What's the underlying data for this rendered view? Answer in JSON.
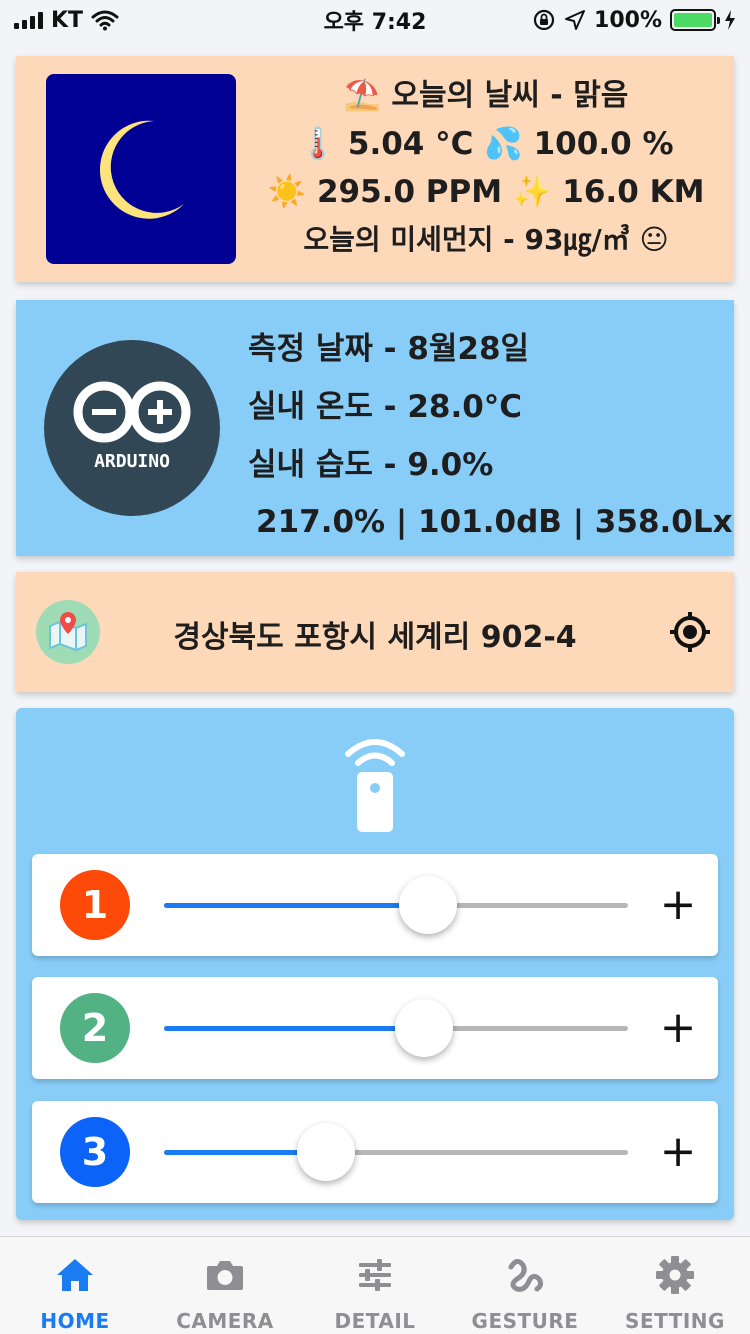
{
  "status_bar": {
    "carrier": "KT",
    "time": "오후 7:42",
    "battery": "100%",
    "battery_level": 1.0
  },
  "weather": {
    "icon": "moon-icon",
    "title_emoji": "⛱️",
    "title": "오늘의 날씨 - 맑음",
    "temp_emoji": "🌡️",
    "temperature": "5.04 °C",
    "humidity_emoji": "💦",
    "humidity": "100.0 %",
    "sun_emoji": "☀️",
    "ppm": "295.0 PPM",
    "sparkle_emoji": "✨",
    "visibility": "16.0 KM",
    "dust": "오늘의 미세먼지 - 93㎍/㎥",
    "dust_emoji": "😐"
  },
  "arduino": {
    "logo_text": "ARDUINO",
    "date": "측정 날짜 - 8월28일",
    "indoor_temp": "실내 온도 - 28.0°C",
    "indoor_humidity": "실내 습도 - 9.0%",
    "stats": "217.0% | 101.0dB | 358.0Lx"
  },
  "location": {
    "address": "경상북도 포항시 세계리 902-4"
  },
  "controls": {
    "sliders": [
      {
        "label": "1",
        "value": 0.57,
        "color": "#fe4a08"
      },
      {
        "label": "2",
        "value": 0.56,
        "color": "#53b283"
      },
      {
        "label": "3",
        "value": 0.35,
        "color": "#0b63f8"
      }
    ],
    "plus": "+"
  },
  "tabs": [
    {
      "label": "HOME",
      "icon": "home-icon",
      "active": true
    },
    {
      "label": "CAMERA",
      "icon": "camera-icon",
      "active": false
    },
    {
      "label": "DETAIL",
      "icon": "sliders-icon",
      "active": false
    },
    {
      "label": "GESTURE",
      "icon": "gesture-icon",
      "active": false
    },
    {
      "label": "SETTING",
      "icon": "gear-icon",
      "active": false
    }
  ],
  "colors": {
    "peach": "#fed9b9",
    "sky": "#88cdf8",
    "accent": "#1a7cf0",
    "moon_bg": "#010095",
    "arduino_bg": "#314755"
  }
}
